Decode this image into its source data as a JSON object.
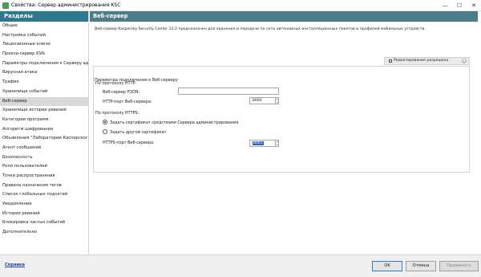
{
  "window": {
    "title": "Свойства: Сервер администрирования KSC",
    "icons": {
      "minimize": "minimize-icon",
      "maximize": "maximize-icon",
      "close": "close-icon"
    }
  },
  "sidebar": {
    "header": "Разделы",
    "items": [
      {
        "label": "Общие"
      },
      {
        "label": "Настройка событий"
      },
      {
        "label": "Лицензионные ключи"
      },
      {
        "label": "Прокси-сервер KSN"
      },
      {
        "label": "Параметры подключения к Серверу админи"
      },
      {
        "label": "Вирусная атака"
      },
      {
        "label": "Трафик"
      },
      {
        "label": "Хранилище событий"
      },
      {
        "label": "Веб-сервер",
        "selected": true
      },
      {
        "label": "Хранилище истории ревизий"
      },
      {
        "label": "Категории программ"
      },
      {
        "label": "Алгоритм шифрования"
      },
      {
        "label": "Объявления \"Лаборатории Касперского\""
      },
      {
        "label": "Агент сообщений"
      },
      {
        "label": "Безопасность"
      },
      {
        "label": "Роли пользователей"
      },
      {
        "label": "Точки распространения"
      },
      {
        "label": "Правила назначения тегов"
      },
      {
        "label": "Список глобальных подсетей"
      },
      {
        "label": "Уведомление"
      },
      {
        "label": "История ревизий"
      },
      {
        "label": "Блокировка частых событий"
      },
      {
        "label": "Дополнительно"
      }
    ]
  },
  "main": {
    "header": "Веб-сервер",
    "description": "Веб-сервер Kaspersky Security Center 13.2 предназначен для хранения и передачи по сети автономных инсталляционных пакетов и профилей мобильных устройств.",
    "edit_status": {
      "label": "Редактирование разрешено",
      "icon": "lock-icon"
    },
    "group_title": "Параметры подключения к Веб-серверу",
    "http": {
      "section_label": "По протоколу HTTP:",
      "fqdn_label": "Веб-сервер FQDN:",
      "fqdn_value": "",
      "port_label": "HTTP-порт Веб-сервера:",
      "port_value": "8060"
    },
    "https": {
      "section_label": "По протоколу HTTPS:",
      "option_admin_cert": "Задать сертификат средствами Сервера администрирования",
      "option_other_cert": "Задать другой сертификат",
      "selected_option": "option_admin_cert",
      "port_label": "HTTPS-порт Веб-сервера:",
      "port_value": "8061"
    }
  },
  "footer": {
    "help_link": "Справка",
    "ok": "OK",
    "cancel": "Отмена",
    "apply": "Применить"
  }
}
